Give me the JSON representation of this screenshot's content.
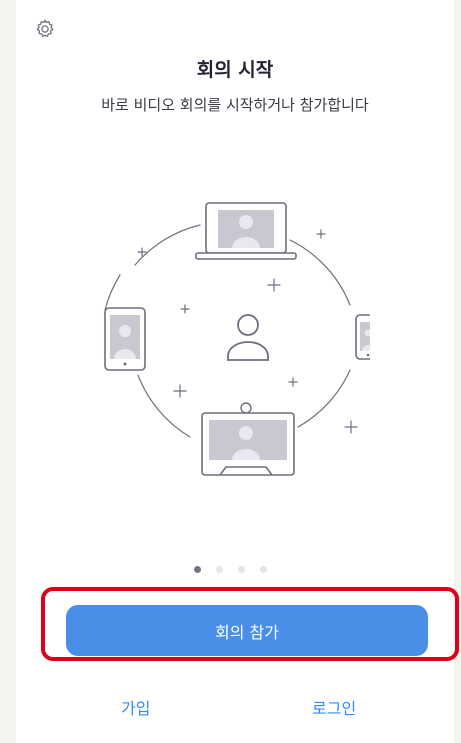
{
  "header": {
    "settings_icon": "gear-icon",
    "title": "회의 시작",
    "subtitle": "바로 비디오 회의를 시작하거나 참가합니다"
  },
  "illustration": {
    "icons": [
      "laptop-icon",
      "tablet-icon",
      "phone-icon",
      "room-system-icon",
      "user-icon"
    ]
  },
  "carousel": {
    "pages": 4,
    "active": 1
  },
  "actions": {
    "join_label": "회의 참가",
    "signup_label": "가입",
    "login_label": "로그인"
  },
  "colors": {
    "accent": "#4a8fe7",
    "link": "#2d8cff",
    "highlight": "#e0001a"
  }
}
